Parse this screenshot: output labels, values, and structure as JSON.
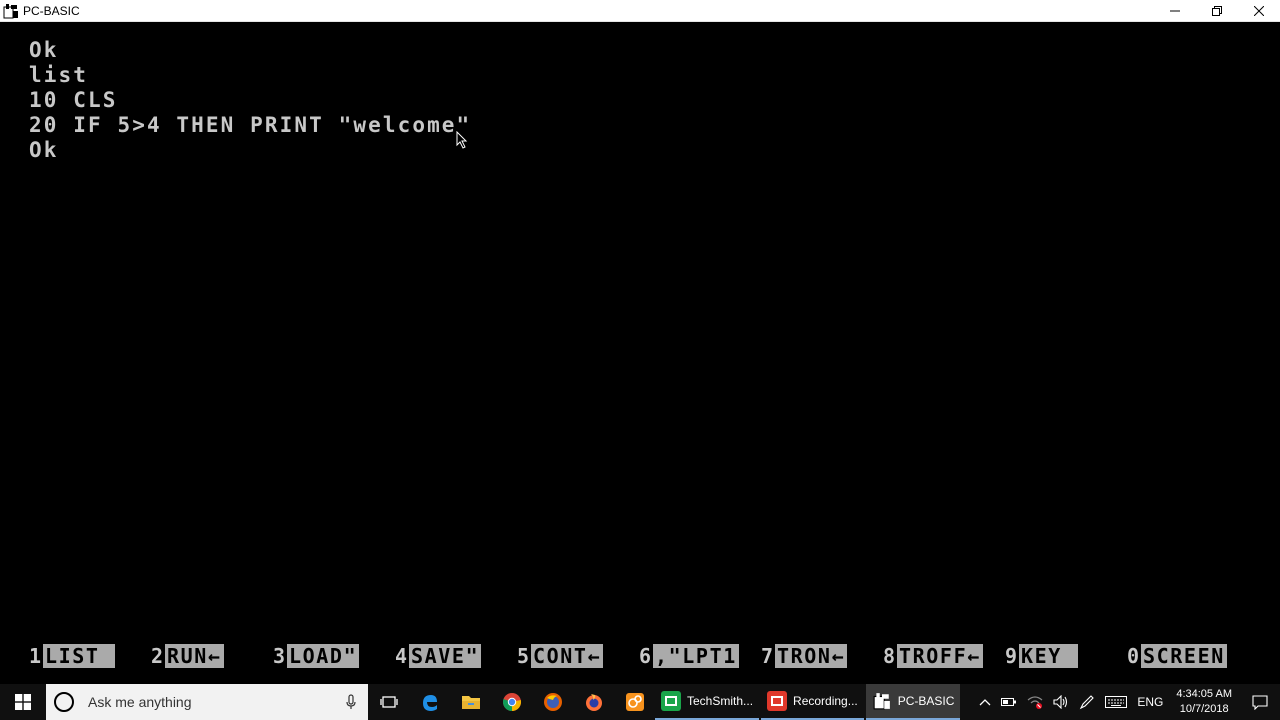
{
  "window": {
    "title": "PC-BASIC",
    "controls": {
      "minimize": "minimize-icon",
      "maximize": "restore-icon",
      "close": "close-icon"
    }
  },
  "console": {
    "lines": [
      "Ok",
      "list",
      "10 CLS",
      "20 IF 5>4 THEN PRINT \"welcome\"",
      "Ok"
    ],
    "text_color": "#c8c8c8",
    "background": "#000000"
  },
  "function_keys": [
    {
      "num": "1",
      "label": "LIST "
    },
    {
      "num": "2",
      "label": "RUN←"
    },
    {
      "num": "3",
      "label": "LOAD\""
    },
    {
      "num": "4",
      "label": "SAVE\""
    },
    {
      "num": "5",
      "label": "CONT←"
    },
    {
      "num": "6",
      "label": ",\"LPT1"
    },
    {
      "num": "7",
      "label": "TRON←"
    },
    {
      "num": "8",
      "label": "TROFF←"
    },
    {
      "num": "9",
      "label": "KEY "
    },
    {
      "num": "0",
      "label": "SCREEN"
    }
  ],
  "taskbar": {
    "search_placeholder": "Ask me anything",
    "pinned_icons": [
      "task-view-icon",
      "edge-icon",
      "file-explorer-icon",
      "chrome-icon",
      "firefox-icon",
      "firefox-dev-icon",
      "app-orange-icon"
    ],
    "apps": [
      {
        "label": "TechSmith...",
        "color": "#1aa54a",
        "active": false
      },
      {
        "label": "Recording...",
        "color": "#e0382b",
        "active": false
      },
      {
        "label": "PC-BASIC",
        "color": "#ffffff",
        "active": true
      }
    ],
    "tray": {
      "language": "ENG",
      "time": "4:34:05 AM",
      "date": "10/7/2018"
    }
  }
}
